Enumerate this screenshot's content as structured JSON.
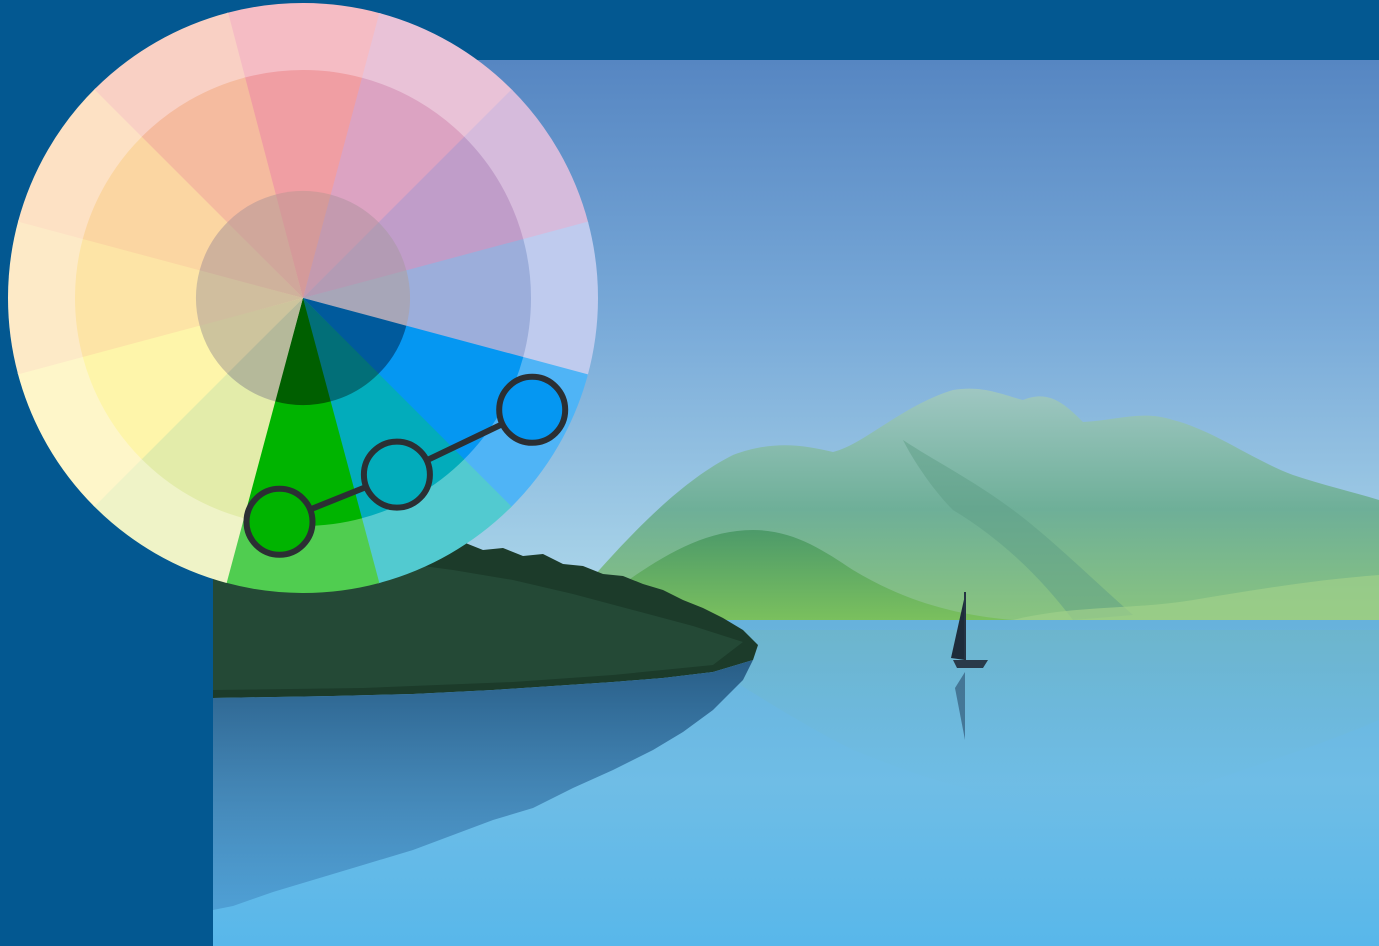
{
  "illustration": {
    "subject": "analogous-color-scheme",
    "background_color": "#035891",
    "photo": {
      "scene": "lake-with-mountains-forest-and-sailboat",
      "sky_top": "#5686c2",
      "sky_bottom": "#a9d6ea",
      "water_top": "#5da7d6",
      "water_bottom": "#7cc8ee"
    },
    "color_wheel": {
      "segment_count": 12,
      "ring_names": [
        "tint-outer",
        "mid",
        "shade-inner"
      ],
      "segments": [
        {
          "hue": "red",
          "outer": "#f5bcc4",
          "mid": "#f09ea3",
          "inner": "#d49a9a"
        },
        {
          "hue": "red-violet",
          "outer": "#e9c2d7",
          "mid": "#dca3c2",
          "inner": "#c49aaf"
        },
        {
          "hue": "violet",
          "outer": "#d6bbdc",
          "mid": "#c09dc9",
          "inner": "#b39bb4"
        },
        {
          "hue": "blue-violet",
          "outer": "#bfcbee",
          "mid": "#9caedb",
          "inner": "#a7a6b8"
        },
        {
          "hue": "blue",
          "outer": "#4fb4f6",
          "mid": "#0597f2",
          "inner": "#005a9c"
        },
        {
          "hue": "blue-green",
          "outer": "#52cad0",
          "mid": "#02acbb",
          "inner": "#026f78"
        },
        {
          "hue": "green",
          "outer": "#50cd50",
          "mid": "#00b400",
          "inner": "#005f00"
        },
        {
          "hue": "yellow-green",
          "outer": "#eff3c7",
          "mid": "#e3ecaa",
          "inner": "#b5b99a"
        },
        {
          "hue": "yellow",
          "outer": "#fef6c9",
          "mid": "#fef5aa",
          "inner": "#cdc49d"
        },
        {
          "hue": "yellow-orange",
          "outer": "#fdeac7",
          "mid": "#fde4a6",
          "inner": "#d0be9e"
        },
        {
          "hue": "orange",
          "outer": "#fde1c4",
          "mid": "#fbd6a2",
          "inner": "#cfb29c"
        },
        {
          "hue": "red-orange",
          "outer": "#f9d0c4",
          "mid": "#f5bb9f",
          "inner": "#d0a79b"
        }
      ],
      "selected_hues": [
        "blue",
        "blue-green",
        "green"
      ],
      "marker_colors": [
        "#0597f2",
        "#02acbb",
        "#00b400"
      ],
      "connector_color": "#2b2f33"
    }
  }
}
